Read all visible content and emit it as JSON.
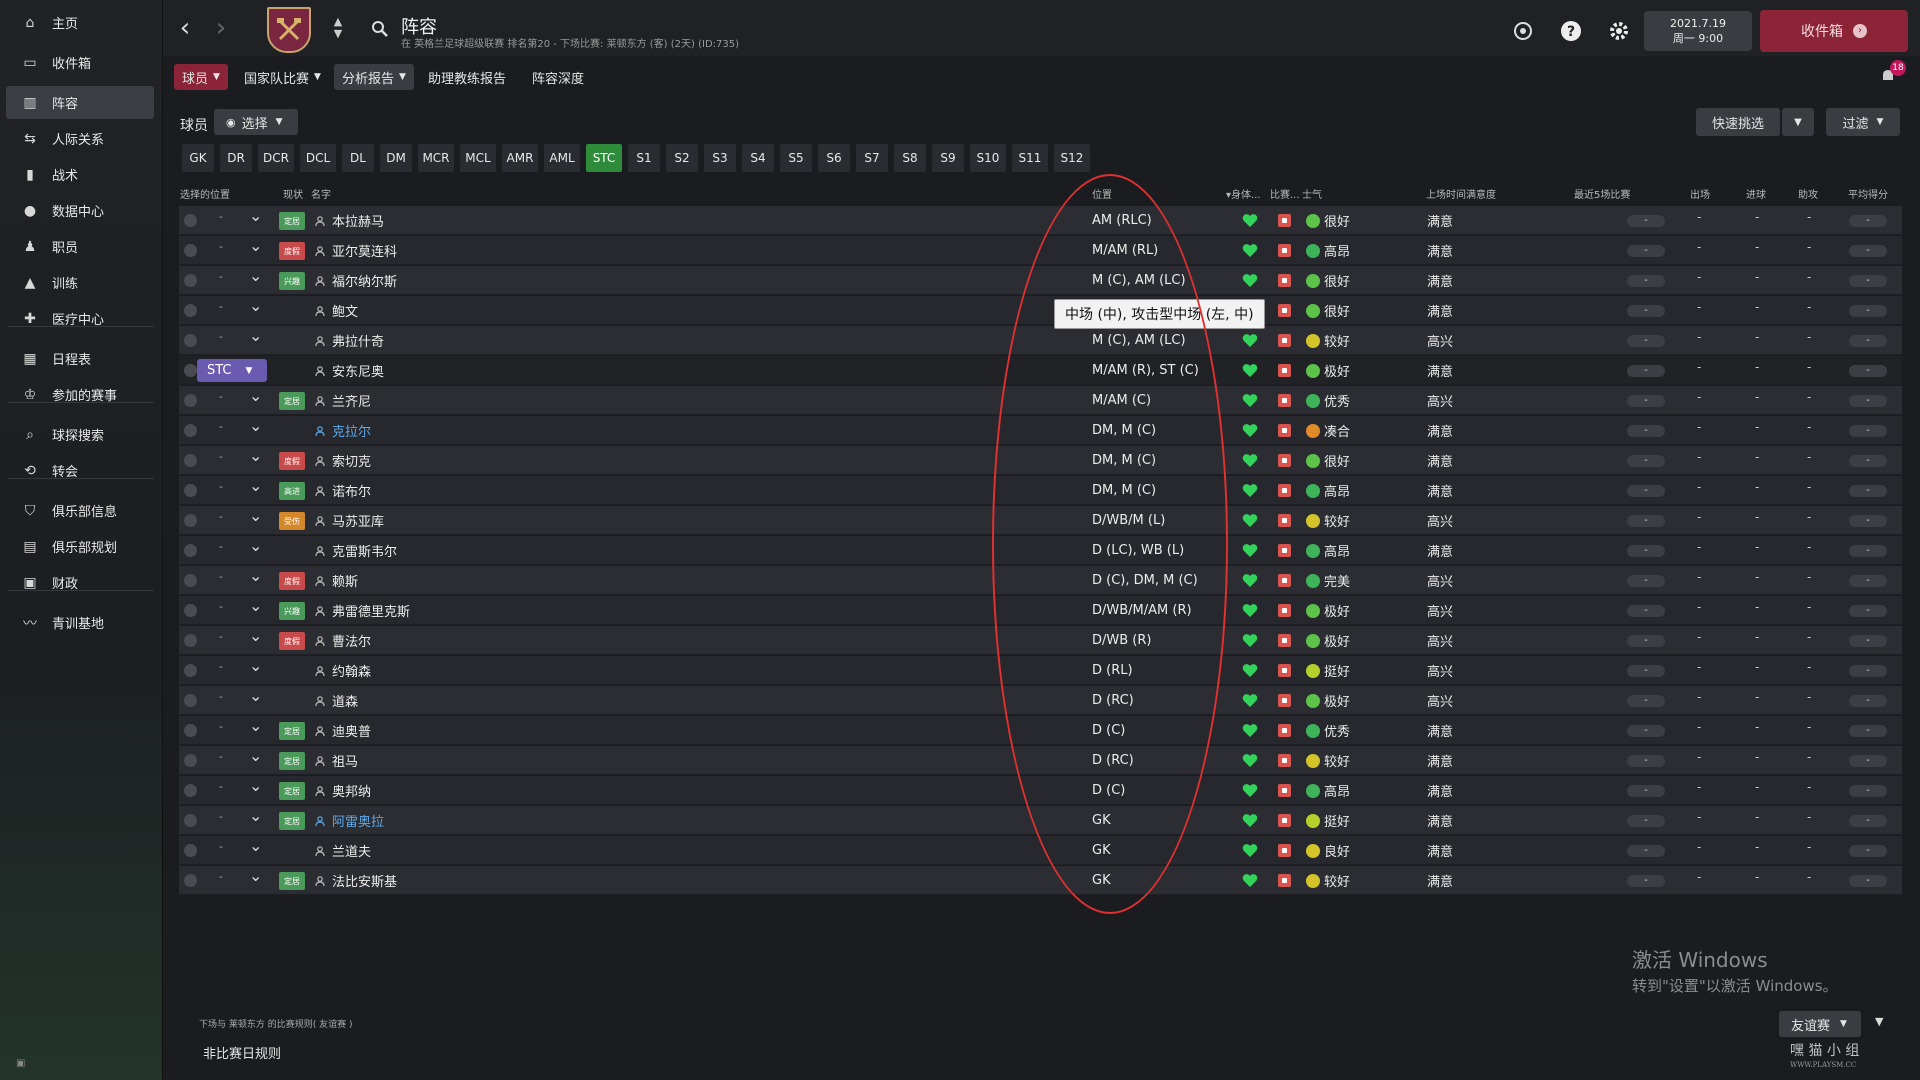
{
  "sidebar": {
    "items": [
      {
        "label": "主页",
        "icon": "home-icon"
      },
      {
        "label": "收件箱",
        "icon": "inbox-icon"
      },
      {
        "label": "阵容",
        "icon": "squad-icon"
      },
      {
        "label": "人际关系",
        "icon": "relationships-icon"
      },
      {
        "label": "战术",
        "icon": "tactics-icon"
      },
      {
        "label": "数据中心",
        "icon": "data-hub-icon"
      },
      {
        "label": "职员",
        "icon": "staff-icon"
      },
      {
        "label": "训练",
        "icon": "training-icon"
      },
      {
        "label": "医疗中心",
        "icon": "medical-icon"
      },
      {
        "label": "日程表",
        "icon": "calendar-icon"
      },
      {
        "label": "参加的赛事",
        "icon": "trophy-icon"
      },
      {
        "label": "球探搜索",
        "icon": "scouting-icon"
      },
      {
        "label": "转会",
        "icon": "transfers-icon"
      },
      {
        "label": "俱乐部信息",
        "icon": "club-info-icon"
      },
      {
        "label": "俱乐部规划",
        "icon": "club-vision-icon"
      },
      {
        "label": "财政",
        "icon": "finances-icon"
      },
      {
        "label": "青训基地",
        "icon": "youth-icon"
      }
    ]
  },
  "header": {
    "title": "阵容",
    "subtitle": "在 英格兰足球超级联赛 排名第20 - 下场比赛: 莱顿东方 (客) (2天) (ID:735)",
    "crest_text": "WEST HAM",
    "date_line1": "2021.7.19",
    "date_line2": "周一 9:00",
    "inbox_label": "收件箱",
    "notification_count": "18"
  },
  "subnav": {
    "players": "球员",
    "international": "国家队比赛",
    "analysis": "分析报告",
    "assistant_report": "助理教练报告",
    "depth": "阵容深度"
  },
  "controls": {
    "players_label": "球员",
    "select_label": "选择",
    "quick_pick": "快速挑选",
    "filter": "过滤"
  },
  "position_tabs": [
    "GK",
    "DR",
    "DCR",
    "DCL",
    "DL",
    "DM",
    "MCR",
    "MCL",
    "AMR",
    "AML",
    "STC",
    "S1",
    "S2",
    "S3",
    "S4",
    "S5",
    "S6",
    "S7",
    "S8",
    "S9",
    "S10",
    "S11",
    "S12"
  ],
  "active_position_tab": "STC",
  "columns": {
    "selected_pos": "选择的位置",
    "status": "现状",
    "name": "名字",
    "position": "位置",
    "condition": "身体...",
    "match": "比赛...",
    "morale": "士气",
    "playtime": "上场时间满意度",
    "last5": "最近5场比赛",
    "apps": "出场",
    "goals": "进球",
    "assists": "助攻",
    "avg_rating": "平均得分"
  },
  "selected_marker": "STC",
  "dash": "-",
  "players": [
    {
      "name": "本拉赫马",
      "status": "定居",
      "status_color": "green",
      "position": "AM (RLC)",
      "morale": "很好",
      "morale_color": "#5cc24a",
      "satisfaction": "满意",
      "link": false
    },
    {
      "name": "亚尔莫连科",
      "status": "度假",
      "status_color": "red",
      "position": "M/AM (RL)",
      "morale": "高昂",
      "morale_color": "#3fb35a",
      "satisfaction": "满意",
      "link": false
    },
    {
      "name": "福尔纳尔斯",
      "status": "兴趣",
      "status_color": "green",
      "position": "M (C), AM (LC)",
      "morale": "很好",
      "morale_color": "#5cc24a",
      "satisfaction": "满意",
      "link": false
    },
    {
      "name": "鲍文",
      "status": "",
      "status_color": "",
      "position": "",
      "morale": "很好",
      "morale_color": "#5cc24a",
      "satisfaction": "满意",
      "link": false
    },
    {
      "name": "弗拉什奇",
      "status": "",
      "status_color": "",
      "position": "M (C), AM (LC)",
      "morale": "较好",
      "morale_color": "#d4c42a",
      "satisfaction": "高兴",
      "link": false
    },
    {
      "name": "安东尼奥",
      "status": "",
      "status_color": "",
      "position": "M/AM (R), ST (C)",
      "morale": "极好",
      "morale_color": "#5cc24a",
      "satisfaction": "满意",
      "link": false,
      "selected": true
    },
    {
      "name": "兰齐尼",
      "status": "定居",
      "status_color": "green",
      "position": "M/AM (C)",
      "morale": "优秀",
      "morale_color": "#3fb35a",
      "satisfaction": "高兴",
      "link": false
    },
    {
      "name": "克拉尔",
      "status": "",
      "status_color": "",
      "position": "DM, M (C)",
      "morale": "凑合",
      "morale_color": "#e08a2a",
      "satisfaction": "满意",
      "link": true
    },
    {
      "name": "索切克",
      "status": "度假",
      "status_color": "red",
      "position": "DM, M (C)",
      "morale": "很好",
      "morale_color": "#5cc24a",
      "satisfaction": "满意",
      "link": false
    },
    {
      "name": "诺布尔",
      "status": "高进",
      "status_color": "green",
      "position": "DM, M (C)",
      "morale": "高昂",
      "morale_color": "#3fb35a",
      "satisfaction": "满意",
      "link": false
    },
    {
      "name": "马苏亚库",
      "status": "受伤",
      "status_color": "orange",
      "position": "D/WB/M (L)",
      "morale": "较好",
      "morale_color": "#d4c42a",
      "satisfaction": "高兴",
      "link": false
    },
    {
      "name": "克雷斯韦尔",
      "status": "",
      "status_color": "",
      "position": "D (LC), WB (L)",
      "morale": "高昂",
      "morale_color": "#3fb35a",
      "satisfaction": "满意",
      "link": false
    },
    {
      "name": "赖斯",
      "status": "度假",
      "status_color": "red",
      "position": "D (C), DM, M (C)",
      "morale": "完美",
      "morale_color": "#3fb35a",
      "satisfaction": "高兴",
      "link": false
    },
    {
      "name": "弗雷德里克斯",
      "status": "兴趣",
      "status_color": "green",
      "position": "D/WB/M/AM (R)",
      "morale": "极好",
      "morale_color": "#5cc24a",
      "satisfaction": "高兴",
      "link": false
    },
    {
      "name": "曹法尔",
      "status": "度假",
      "status_color": "red",
      "position": "D/WB (R)",
      "morale": "极好",
      "morale_color": "#5cc24a",
      "satisfaction": "高兴",
      "link": false
    },
    {
      "name": "约翰森",
      "status": "",
      "status_color": "",
      "position": "D (RL)",
      "morale": "挺好",
      "morale_color": "#b5d02a",
      "satisfaction": "高兴",
      "link": false
    },
    {
      "name": "道森",
      "status": "",
      "status_color": "",
      "position": "D (RC)",
      "morale": "极好",
      "morale_color": "#5cc24a",
      "satisfaction": "高兴",
      "link": false
    },
    {
      "name": "迪奥普",
      "status": "定居",
      "status_color": "green",
      "position": "D (C)",
      "morale": "优秀",
      "morale_color": "#3fb35a",
      "satisfaction": "满意",
      "link": false
    },
    {
      "name": "祖马",
      "status": "定居",
      "status_color": "green",
      "position": "D (RC)",
      "morale": "较好",
      "morale_color": "#d4c42a",
      "satisfaction": "满意",
      "link": false
    },
    {
      "name": "奥邦纳",
      "status": "定居",
      "status_color": "green",
      "position": "D (C)",
      "morale": "高昂",
      "morale_color": "#3fb35a",
      "satisfaction": "满意",
      "link": false
    },
    {
      "name": "阿雷奥拉",
      "status": "定居",
      "status_color": "green",
      "position": "GK",
      "morale": "挺好",
      "morale_color": "#b5d02a",
      "satisfaction": "满意",
      "link": true
    },
    {
      "name": "兰道夫",
      "status": "",
      "status_color": "",
      "position": "GK",
      "morale": "良好",
      "morale_color": "#d4c42a",
      "satisfaction": "满意",
      "link": false
    },
    {
      "name": "法比安斯基",
      "status": "定居",
      "status_color": "green",
      "position": "GK",
      "morale": "较好",
      "morale_color": "#d4c42a",
      "satisfaction": "满意",
      "link": false
    }
  ],
  "tooltip": "中场 (中), 攻击型中场 (左, 中)",
  "windows_activation": {
    "line1": "激活 Windows",
    "line2": "转到\"设置\"以激活 Windows。"
  },
  "bottom": {
    "caption": "下场与 莱顿东方 的比赛规则( 友谊赛 )",
    "rule": "非比赛日规则",
    "friendly": "友谊赛"
  },
  "watermark": {
    "line1": "嘿 猫 小 组",
    "line2": "WWW.PLAYSM.CC"
  }
}
